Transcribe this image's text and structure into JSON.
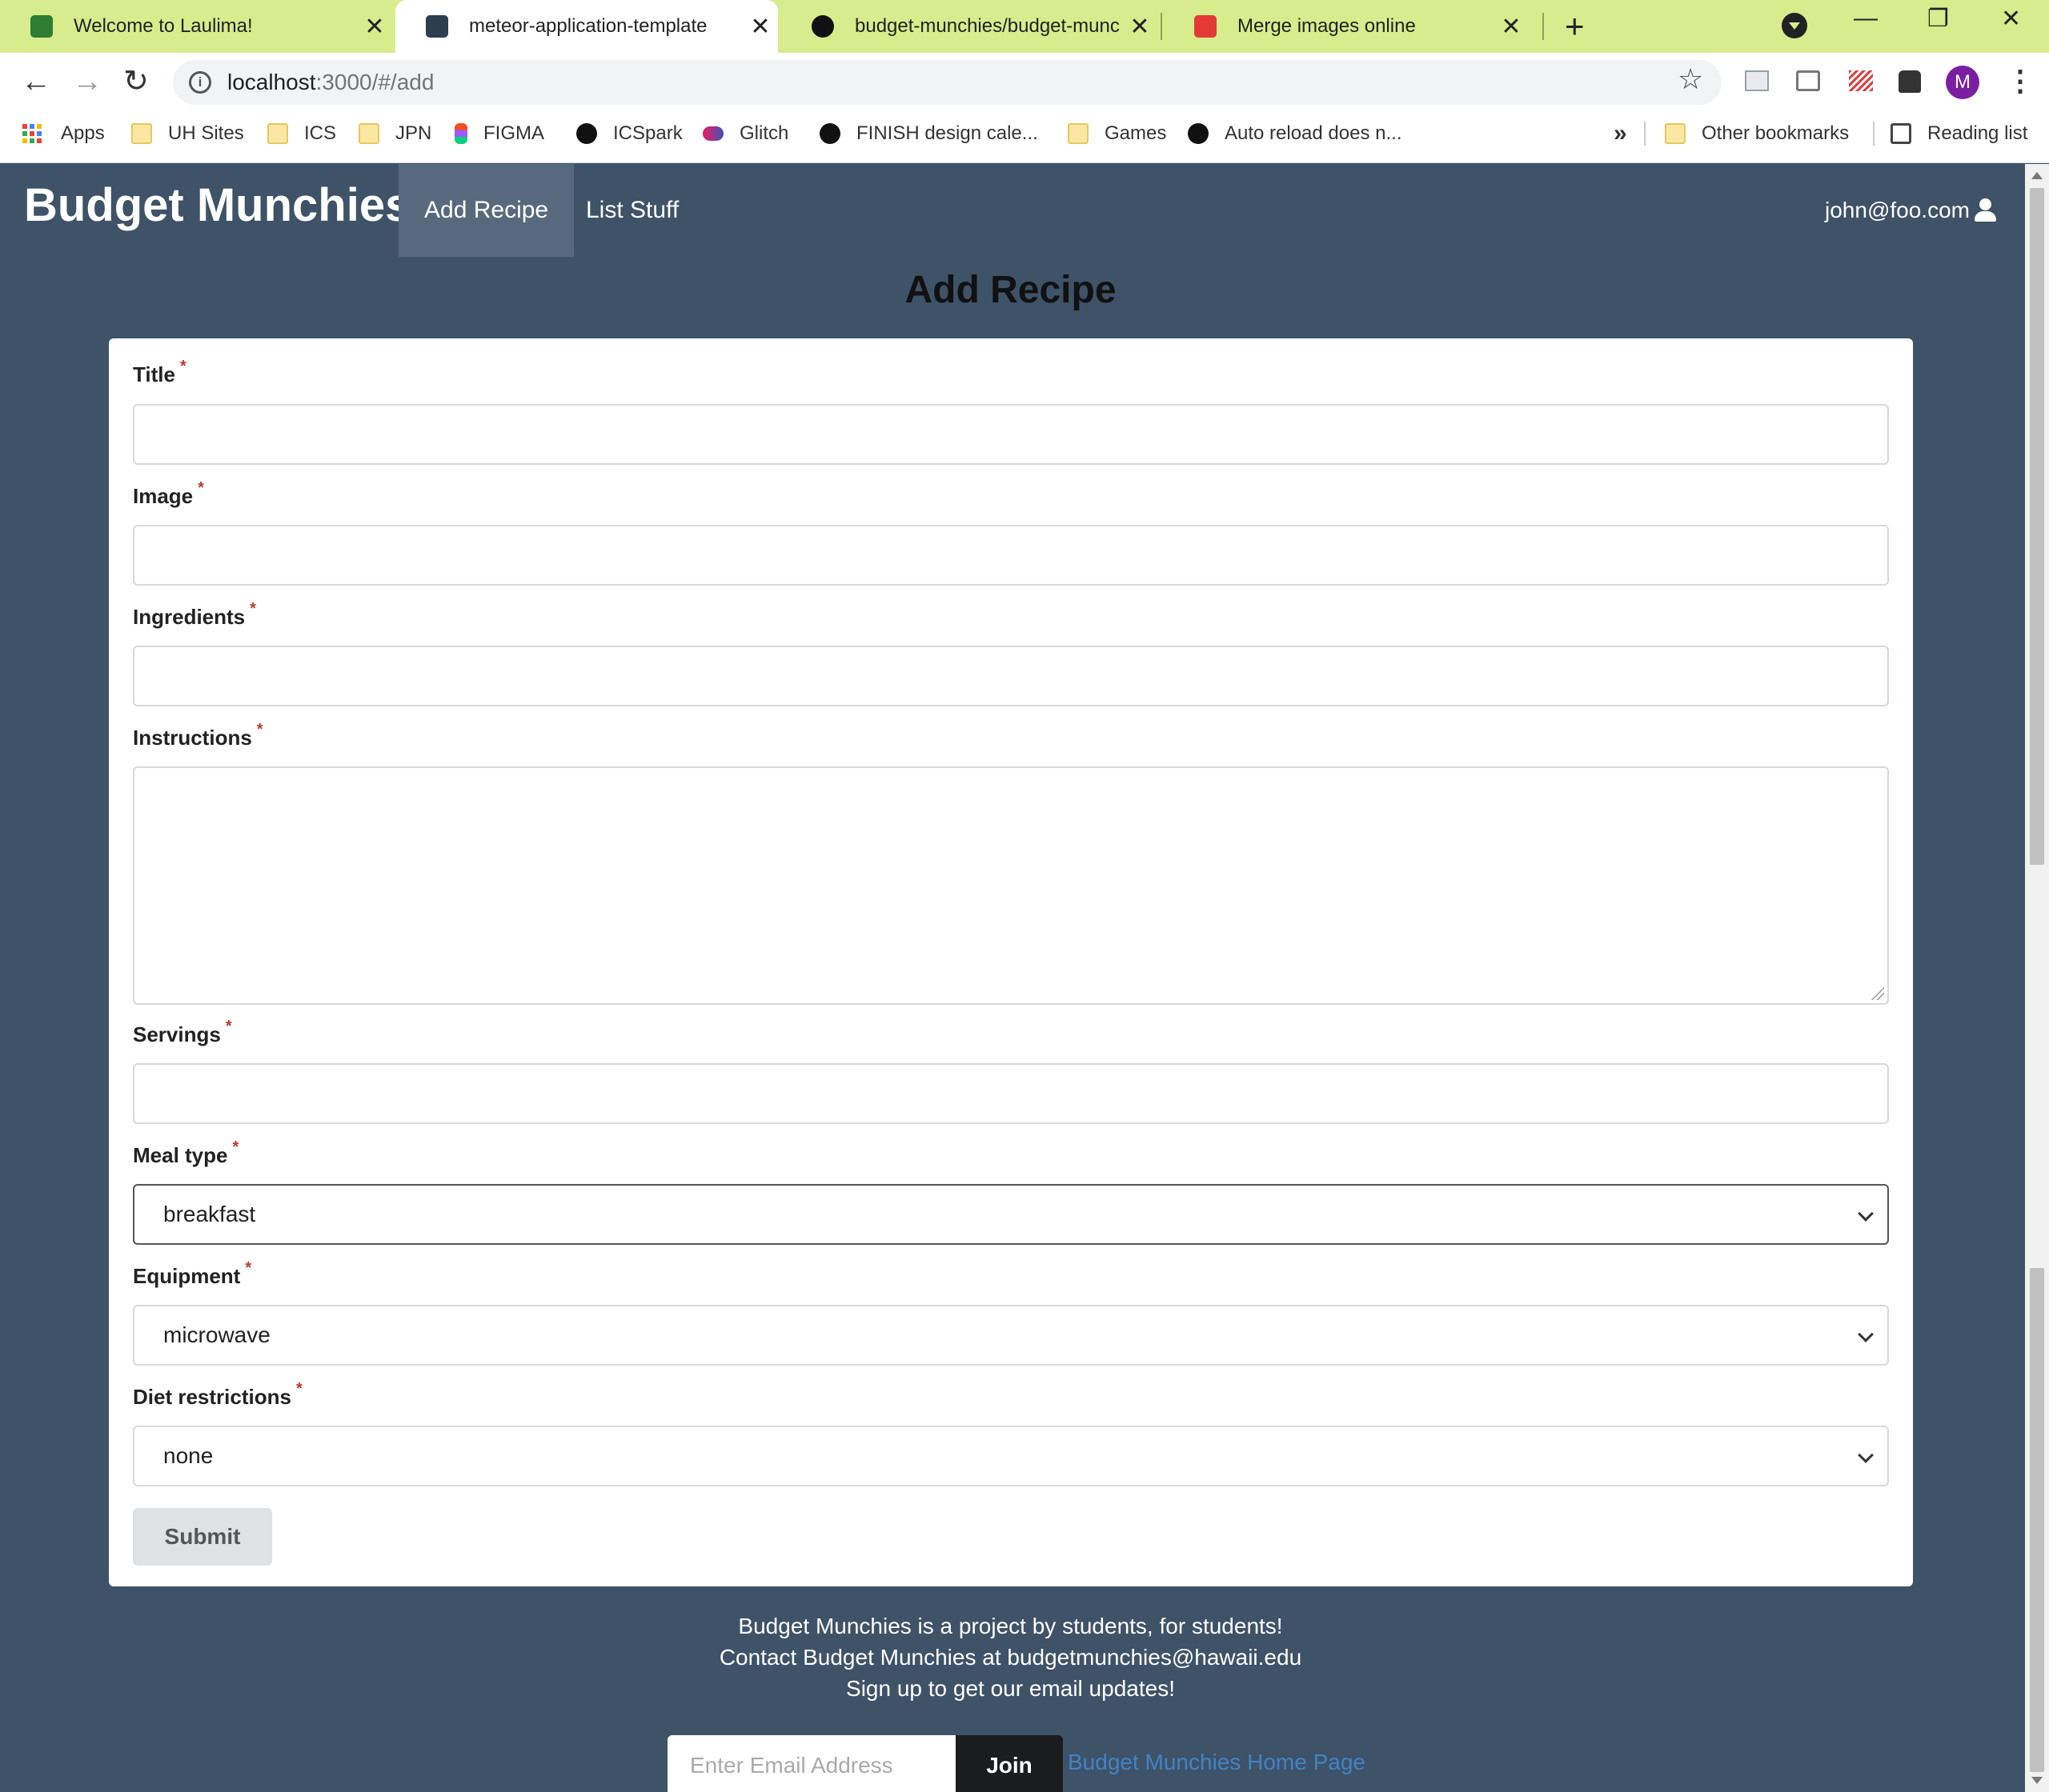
{
  "browser": {
    "tabs": [
      {
        "title": "Welcome to Laulima!",
        "favicon_color": "#2e7d32"
      },
      {
        "title": "meteor-application-template",
        "favicon_color": "#2c3e50"
      },
      {
        "title": "budget-munchies/budget-munc",
        "favicon_color": "#111111"
      },
      {
        "title": "Merge images online",
        "favicon_color": "#e53935"
      }
    ],
    "address": {
      "host": "localhost",
      "path": ":3000/#/add"
    },
    "profile_initial": "M",
    "bookmarks": [
      {
        "label": "Apps",
        "icon": "apps-grid-icon"
      },
      {
        "label": "UH Sites",
        "icon": "folder-icon"
      },
      {
        "label": "ICS",
        "icon": "folder-icon"
      },
      {
        "label": "JPN",
        "icon": "folder-icon"
      },
      {
        "label": "FIGMA",
        "icon": "figma-icon"
      },
      {
        "label": "ICSpark",
        "icon": "globe-icon"
      },
      {
        "label": "Glitch",
        "icon": "glitch-icon"
      },
      {
        "label": "FINISH design cale...",
        "icon": "github-icon"
      },
      {
        "label": "Games",
        "icon": "folder-icon"
      },
      {
        "label": "Auto reload does n...",
        "icon": "github-icon"
      }
    ],
    "bookmarks_more": "»",
    "other_bookmarks": "Other bookmarks",
    "reading_list": "Reading list"
  },
  "app": {
    "brand": "Budget Munchies",
    "nav": [
      {
        "label": "Add Recipe",
        "active": true
      },
      {
        "label": "List Stuff",
        "active": false
      }
    ],
    "user_email": "john@foo.com"
  },
  "form": {
    "heading": "Add Recipe",
    "required_mark": "*",
    "fields": {
      "title": {
        "label": "Title",
        "value": ""
      },
      "image": {
        "label": "Image",
        "value": ""
      },
      "ingredients": {
        "label": "Ingredients",
        "value": ""
      },
      "instructions": {
        "label": "Instructions",
        "value": ""
      },
      "servings": {
        "label": "Servings",
        "value": ""
      },
      "meal_type": {
        "label": "Meal type",
        "value": "breakfast"
      },
      "equipment": {
        "label": "Equipment",
        "value": "microwave"
      },
      "diet": {
        "label": "Diet restrictions",
        "value": "none"
      }
    },
    "submit_label": "Submit"
  },
  "footer": {
    "line1": "Budget Munchies is a project by students, for students!",
    "line2": "Contact Budget Munchies at budgetmunchies@hawaii.edu",
    "line3": "Sign up to get our email updates!",
    "email_placeholder": "Enter Email Address",
    "join_label": "Join",
    "home_link": "Budget Munchies Home Page"
  },
  "colors": {
    "tab_strip": "#d7ec8c",
    "page_bg": "#3e5268",
    "nav_active": "#58697d",
    "required": "#c0392b",
    "link": "#4183c4"
  }
}
